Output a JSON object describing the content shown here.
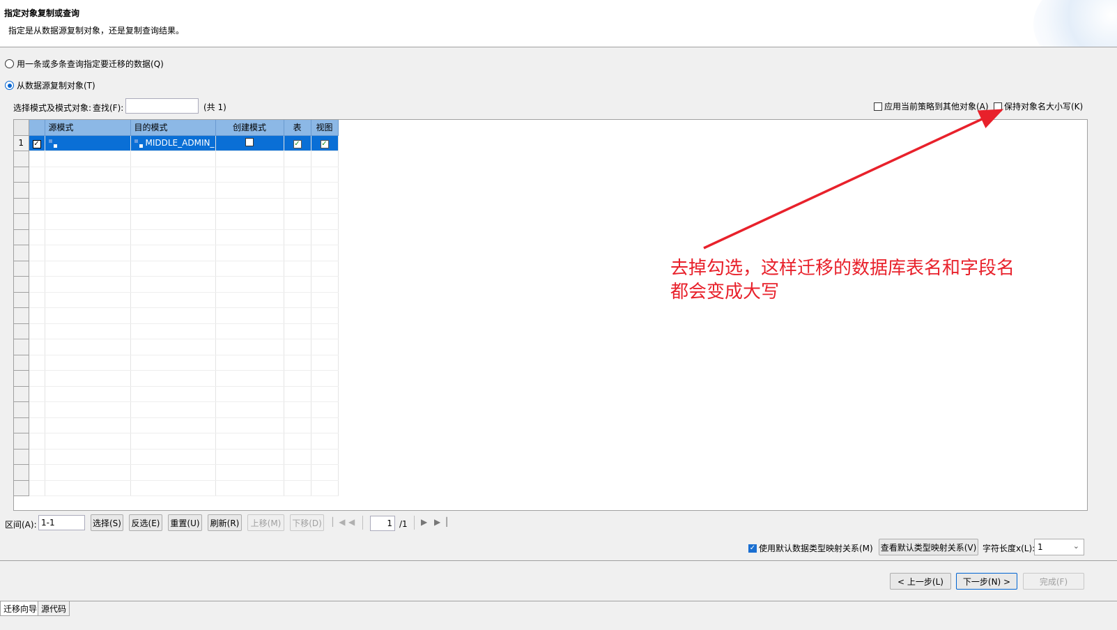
{
  "header": {
    "title": "指定对象复制或查询",
    "subtitle": "指定是从数据源复制对象，还是复制查询结果。"
  },
  "options": {
    "query_option": "用一条或多条查询指定要迁移的数据(Q)",
    "copy_option": "从数据源复制对象(T)",
    "selected": "copy"
  },
  "filter": {
    "label": "选择模式及模式对象:",
    "find_label": "查找(F):",
    "find_value": "",
    "count": "(共 1)"
  },
  "right_options": {
    "apply_policy": "应用当前策略到其他对象(A)",
    "apply_policy_checked": false,
    "keep_case": "保持对象名大小写(K)",
    "keep_case_checked": false
  },
  "table": {
    "columns": [
      "源模式",
      "目的模式",
      "创建模式",
      "表",
      "视图"
    ],
    "rows": [
      {
        "num": "1",
        "selected": true,
        "source": "",
        "target": "MIDDLE_ADMIN_",
        "create_mode": false,
        "table": true,
        "view": true
      }
    ]
  },
  "pager": {
    "range_label": "区间(A):",
    "range_value": "1-1",
    "select_btn": "选择(S)",
    "invert_btn": "反选(E)",
    "reset_btn": "重置(U)",
    "refresh_btn": "刷新(R)",
    "up_btn": "上移(M)",
    "down_btn": "下移(D)",
    "page": "1",
    "total": "/1"
  },
  "mapping": {
    "use_default": "使用默认数据类型映射关系(M)",
    "use_default_checked": true,
    "view_default": "查看默认类型映射关系(V)",
    "char_len_label": "字符长度x(L):",
    "char_len_value": "1"
  },
  "wizard": {
    "prev": "< 上一步(L)",
    "next": "下一步(N) >",
    "finish": "完成(F)"
  },
  "tabs": [
    "迁移向导",
    "源代码"
  ],
  "annotation": {
    "line1": "去掉勾选，这样迁移的数据库表名和字段名",
    "line2": "都会变成大写",
    "color": "#e8212b"
  }
}
